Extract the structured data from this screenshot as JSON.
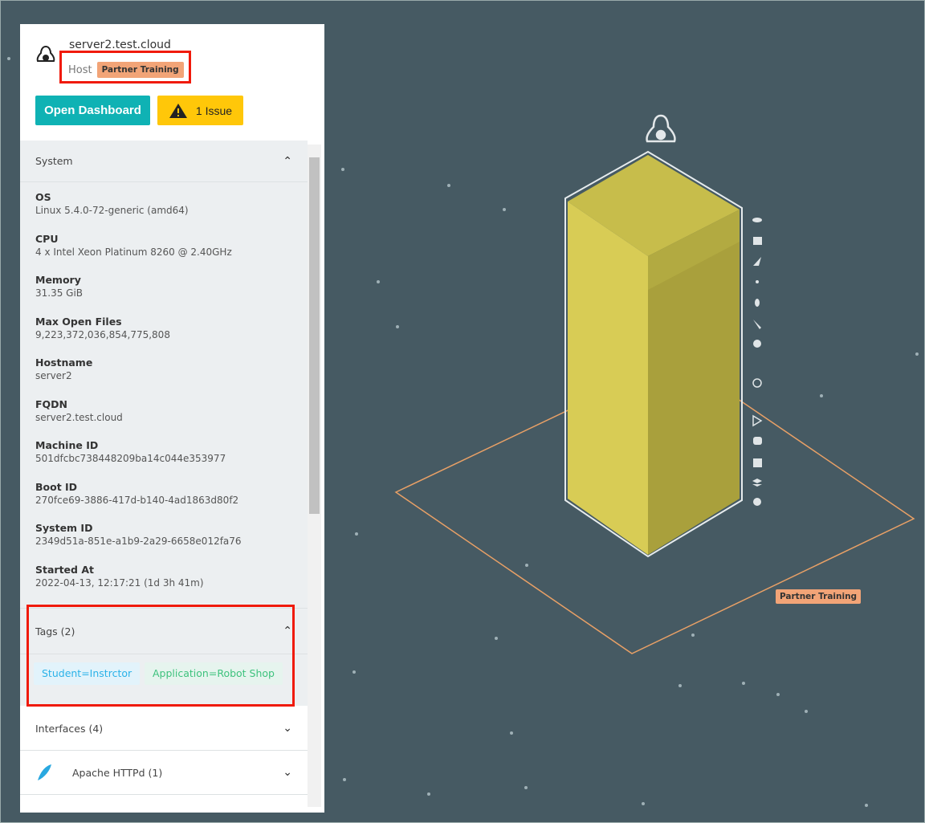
{
  "host": {
    "title": "server2.test.cloud",
    "type_label": "Host",
    "zone_badge": "Partner Training",
    "os_icon": "linux-penguin-icon"
  },
  "actions": {
    "open_dashboard": "Open Dashboard",
    "issues": "1 Issue"
  },
  "system": {
    "title": "System",
    "fields": [
      {
        "label": "OS",
        "value": "Linux 5.4.0-72-generic (amd64)"
      },
      {
        "label": "CPU",
        "value": "4 x Intel Xeon Platinum 8260 @ 2.40GHz"
      },
      {
        "label": "Memory",
        "value": "31.35 GiB"
      },
      {
        "label": "Max Open Files",
        "value": "9,223,372,036,854,775,808"
      },
      {
        "label": "Hostname",
        "value": "server2"
      },
      {
        "label": "FQDN",
        "value": "server2.test.cloud"
      },
      {
        "label": "Machine ID",
        "value": "501dfcbc738448209ba14c044e353977"
      },
      {
        "label": "Boot ID",
        "value": "270fce69-3886-417d-b140-4ad1863d80f2"
      },
      {
        "label": "System ID",
        "value": "2349d51a-851e-a1b9-2a29-6658e012fa76"
      },
      {
        "label": "Started At",
        "value": "2022-04-13, 12:17:21 (1d 3h 41m)"
      }
    ]
  },
  "tags": {
    "title": "Tags (2)",
    "items": [
      "Student=Instrctor",
      "Application=Robot Shop"
    ]
  },
  "interfaces": {
    "title": "Interfaces (4)"
  },
  "apache": {
    "title": "Apache HTTPd (1)"
  },
  "scene": {
    "zone_label": "Partner Training",
    "colors": {
      "background": "#465a63",
      "host": "#d4c94a",
      "zone": "#e8a066"
    }
  }
}
